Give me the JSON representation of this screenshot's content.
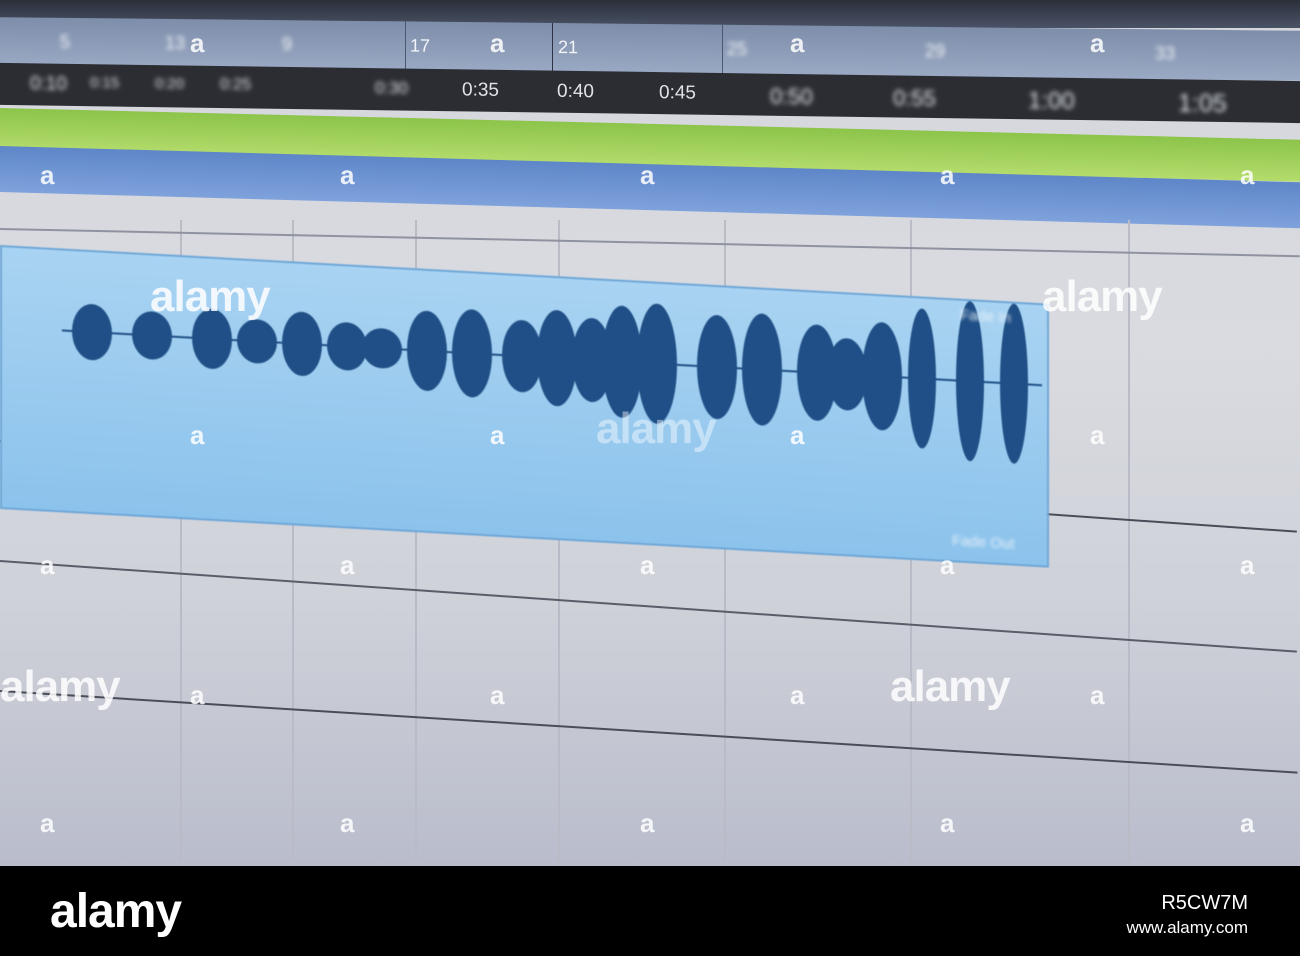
{
  "ruler": {
    "bars": [
      "5",
      "9",
      "13",
      "17",
      "21",
      "25",
      "29",
      "33"
    ]
  },
  "timeline": {
    "times": [
      "0:10",
      "0:15",
      "0:20",
      "0:25",
      "0:30",
      "0:35",
      "0:40",
      "0:45",
      "0:50",
      "0:55",
      "1:00",
      "1:05"
    ]
  },
  "clip": {
    "fade_in_label": "Fade In",
    "fade_out_label": "Fade Out",
    "color": "#9ccbf0",
    "waveform_color": "#1f4f86"
  },
  "tracks": {
    "green_color": "#a4d25c",
    "blue_color": "#6f94d4"
  },
  "watermark": {
    "text": "alamy",
    "glyph": "a"
  },
  "footer": {
    "logo": "alamy",
    "image_id": "R5CW7M",
    "url": "www.alamy.com"
  }
}
